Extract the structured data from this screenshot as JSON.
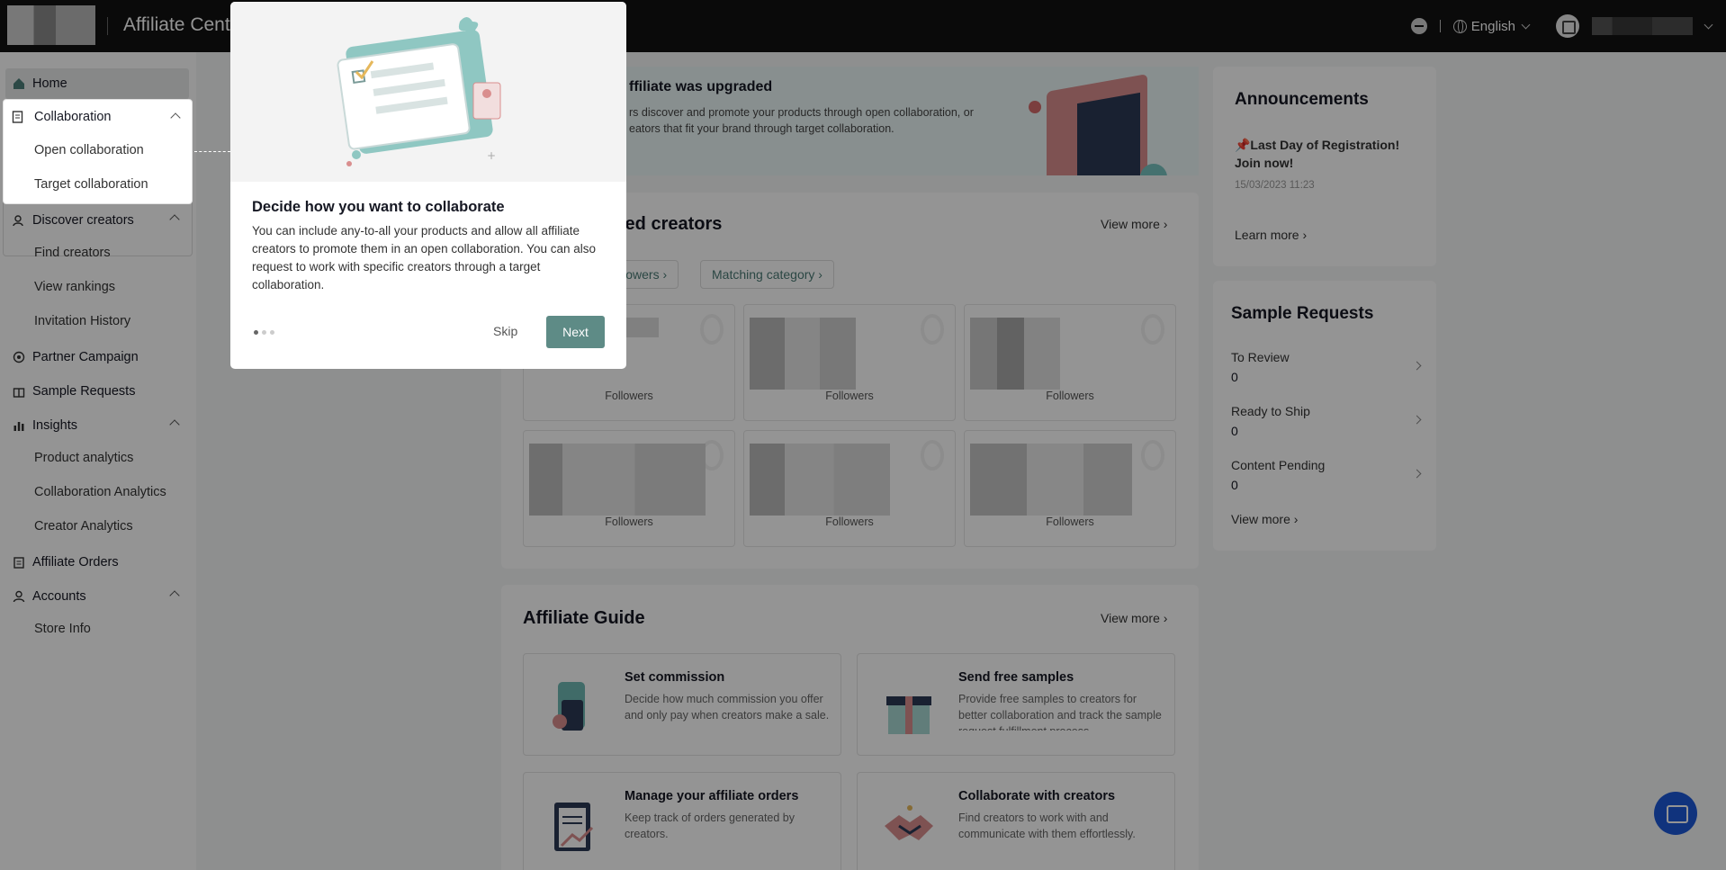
{
  "header": {
    "app_title": "Affiliate Cent",
    "language": "English"
  },
  "sidebar": {
    "home": "Home",
    "collaboration": "Collaboration",
    "open_collaboration": "Open collaboration",
    "target_collaboration": "Target collaboration",
    "discover_creators": "Discover creators",
    "find_creators": "Find creators",
    "view_rankings": "View rankings",
    "invitation_history": "Invitation History",
    "partner_campaign": "Partner Campaign",
    "sample_requests": "Sample Requests",
    "insights": "Insights",
    "product_analytics": "Product analytics",
    "collaboration_analytics": "Collaboration Analytics",
    "creator_analytics": "Creator Analytics",
    "affiliate_orders": "Affiliate Orders",
    "accounts": "Accounts",
    "store_info": "Store Info"
  },
  "banner": {
    "title": "ffiliate was upgraded",
    "text": "rs discover and promote your products through open collaboration, or\neators that fit your brand through target collaboration."
  },
  "recommended": {
    "title": "led creators",
    "view_more": "View more",
    "filter_followers": "llowers",
    "filter_category": "Matching category",
    "followers_label": "Followers"
  },
  "guide": {
    "title": "Affiliate Guide",
    "view_more": "View more",
    "items": [
      {
        "title": "Set commission",
        "desc": "Decide how much commission you offer and only pay when creators make a sale."
      },
      {
        "title": "Send free samples",
        "desc": "Provide free samples to creators for better collaboration and track the sample request fulfillment process."
      },
      {
        "title": "Manage your affiliate orders",
        "desc": "Keep track of orders generated by creators."
      },
      {
        "title": "Collaborate with creators",
        "desc": "Find creators to work with and communicate with them effortlessly."
      }
    ]
  },
  "announcements": {
    "title": "Announcements",
    "item_title": "📌Last Day of Registration! Join now!",
    "item_date": "15/03/2023 11:23",
    "learn_more": "Learn more"
  },
  "sample_requests": {
    "title": "Sample Requests",
    "rows": [
      {
        "label": "To Review",
        "value": "0"
      },
      {
        "label": "Ready to Ship",
        "value": "0"
      },
      {
        "label": "Content Pending",
        "value": "0"
      }
    ],
    "view_more": "View more"
  },
  "tour": {
    "title": "Decide how you want to collaborate",
    "body": "You can include any-to-all your products and allow all affiliate creators to promote them in an open collaboration. You can also request to work with specific creators through a target collaboration.",
    "skip": "Skip",
    "next": "Next",
    "step": 1,
    "total_steps": 3
  }
}
